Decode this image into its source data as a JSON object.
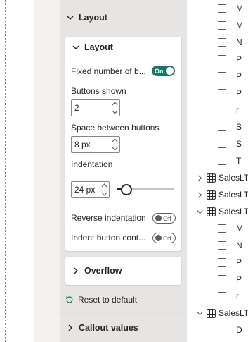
{
  "format_pane": {
    "section_layout": "Layout",
    "card_layout": {
      "title": "Layout",
      "fixed_label": "Fixed number of b...",
      "fixed_toggle": "On",
      "buttons_shown_label": "Buttons shown",
      "buttons_shown_value": "2",
      "space_label": "Space between buttons",
      "space_value": "8 px",
      "indentation_label": "Indentation",
      "indentation_value": "24 px",
      "indentation_level": 0.12,
      "reverse_label": "Reverse indentation",
      "reverse_toggle": "Off",
      "indent_label": "Indent button cont...",
      "indent_toggle": "Off"
    },
    "card_overflow": {
      "title": "Overflow"
    },
    "reset_label": "Reset to default",
    "section_callout": "Callout values"
  },
  "field_list": {
    "group1_items": [
      "M",
      "M",
      "N",
      "P",
      "P",
      "P",
      "r",
      "S",
      "S",
      "T"
    ],
    "tables": [
      {
        "name": "SalesLT",
        "expanded": false
      },
      {
        "name": "SalesLT",
        "expanded": false
      },
      {
        "name": "SalesLT",
        "expanded": true,
        "items": [
          "M",
          "N",
          "P",
          "P",
          "r"
        ]
      },
      {
        "name": "SalesLT",
        "expanded": true,
        "items": [
          "D"
        ]
      }
    ]
  },
  "colors": {
    "accent": "#117865",
    "pane_bg": "#f3f2f1",
    "card_bg": "#ffffff"
  },
  "icons": [
    "chevron-down-icon",
    "chevron-right-icon",
    "spin-up-icon",
    "spin-down-icon",
    "reset-icon",
    "table-icon",
    "checkbox-icon"
  ]
}
